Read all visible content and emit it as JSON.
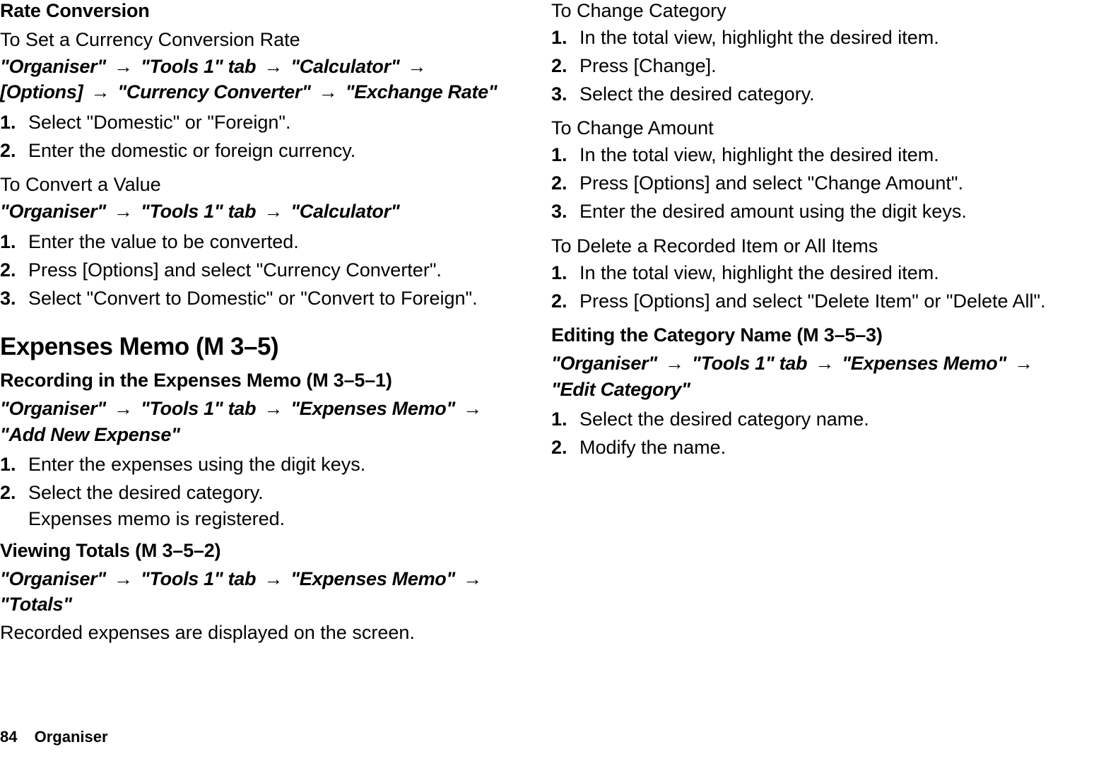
{
  "footer": {
    "page": "84",
    "section": "Organiser"
  },
  "arrow": "→",
  "left": {
    "rateConv": {
      "heading": "Rate Conversion",
      "setRate": {
        "sub": "To Set a Currency Conversion Rate",
        "pathSegs": [
          "\"Organiser\"",
          "\"Tools 1\" tab",
          "\"Calculator\"",
          "[Options]",
          "\"Currency Converter\"",
          "\"Exchange Rate\""
        ],
        "steps": [
          "Select \"Domestic\" or \"Foreign\".",
          "Enter the domestic or foreign currency."
        ]
      },
      "convert": {
        "sub": "To Convert a Value",
        "pathSegs": [
          "\"Organiser\"",
          "\"Tools 1\" tab",
          "\"Calculator\""
        ],
        "steps": [
          "Enter the value to be converted.",
          "Press [Options] and select \"Currency Converter\".",
          "Select \"Convert to Domestic\" or \"Convert to Foreign\"."
        ]
      }
    },
    "expenses": {
      "heading": "Expenses Memo",
      "headingCode": "(M 3–5)",
      "record": {
        "boldSub": "Recording in the Expenses Memo",
        "boldCode": "(M 3–5–1)",
        "pathSegs": [
          "\"Organiser\"",
          "\"Tools 1\" tab",
          "\"Expenses Memo\"",
          "\"Add New Expense\""
        ],
        "steps": [
          "Enter the expenses using the digit keys.",
          "Select the desired category."
        ],
        "note": "Expenses memo is registered."
      },
      "totals": {
        "boldSub": "Viewing Totals",
        "boldCode": "(M 3–5–2)",
        "pathSegs": [
          "\"Organiser\"",
          "\"Tools 1\" tab",
          "\"Expenses Memo\"",
          "\"Totals\""
        ],
        "note": "Recorded expenses are displayed on the screen."
      }
    }
  },
  "right": {
    "changeCat": {
      "sub": "To Change Category",
      "steps": [
        "In the total view, highlight the desired item.",
        "Press [Change].",
        "Select the desired category."
      ]
    },
    "changeAmt": {
      "sub": "To Change Amount",
      "steps": [
        "In the total view, highlight the desired item.",
        "Press [Options] and select \"Change Amount\".",
        "Enter the desired amount using the digit keys."
      ]
    },
    "delete": {
      "sub": "To Delete a Recorded Item or All Items",
      "steps": [
        "In the total view, highlight the desired item.",
        "Press [Options] and select \"Delete Item\" or \"Delete All\"."
      ]
    },
    "editCat": {
      "boldSub": "Editing the Category Name",
      "boldCode": "(M 3–5–3)",
      "pathSegs": [
        "\"Organiser\"",
        "\"Tools 1\" tab",
        "\"Expenses Memo\"",
        "\"Edit Category\""
      ],
      "steps": [
        "Select the desired category name.",
        "Modify the name."
      ]
    }
  }
}
